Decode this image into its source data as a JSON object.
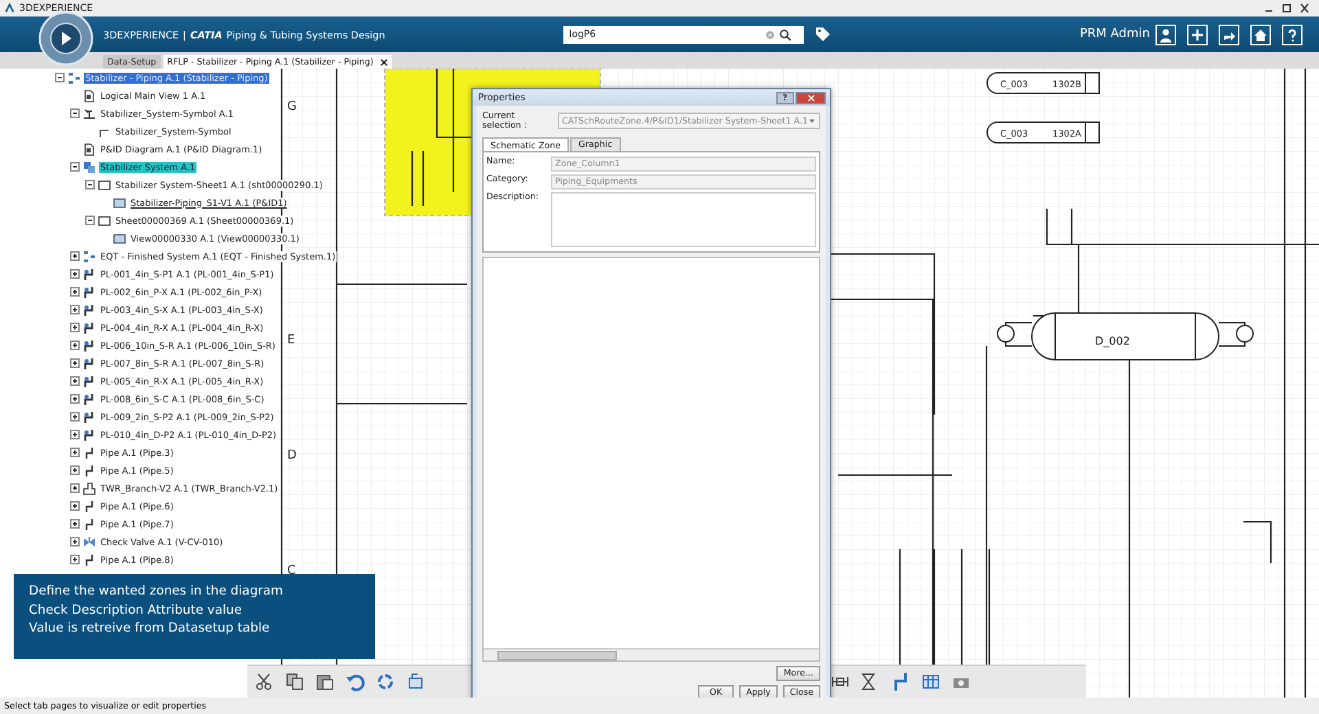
{
  "window": {
    "title": "3DEXPERIENCE"
  },
  "header": {
    "brand": "3DEXPERIENCE",
    "separator": "|",
    "app": "CATIA",
    "app_name": "Piping & Tubing Systems Design",
    "search": {
      "value": "logP6"
    },
    "user": "PRM Admin"
  },
  "tabs": [
    {
      "label": "Data-Setup",
      "selected": false
    },
    {
      "label": "RFLP - Stabilizer - Piping A.1 (Stabilizer - Piping)",
      "selected": true
    }
  ],
  "tree": [
    {
      "label": "Stabilizer - Piping A.1 (Stabilizer - Piping)",
      "kind": "product",
      "expanded": true,
      "selected": true,
      "children": [
        {
          "label": "Logical Main View 1 A.1",
          "kind": "document"
        },
        {
          "label": "Stabilizer_System-Symbol A.1",
          "kind": "symbol",
          "expanded": true,
          "children": [
            {
              "label": "Stabilizer_System-Symbol",
              "kind": "symbol-part"
            }
          ]
        },
        {
          "label": "P&ID Diagram A.1 (P&ID Diagram.1)",
          "kind": "document"
        },
        {
          "label": "Stabilizer System A.1",
          "kind": "system",
          "expanded": true,
          "in_work": true,
          "children": [
            {
              "label": "Stabilizer System-Sheet1 A.1 (sht00000290.1)",
              "kind": "sheet",
              "expanded": true,
              "children": [
                {
                  "label": "Stabilizer-Piping_S1-V1 A.1 (P&ID1)",
                  "kind": "view",
                  "current": true
                }
              ]
            },
            {
              "label": "Sheet00000369 A.1 (Sheet00000369.1)",
              "kind": "sheet",
              "expanded": true,
              "children": [
                {
                  "label": "View00000330 A.1 (View00000330.1)",
                  "kind": "view"
                }
              ]
            }
          ]
        },
        {
          "label": "EQT - Finished System A.1 (EQT - Finished System.1)",
          "kind": "product",
          "expanded": false
        },
        {
          "label": "PL-001_4in_S-P1 A.1 (PL-001_4in_S-P1)",
          "kind": "line",
          "expanded": false
        },
        {
          "label": "PL-002_6in_P-X A.1 (PL-002_6in_P-X)",
          "kind": "line",
          "expanded": false
        },
        {
          "label": "PL-003_4in_S-X A.1 (PL-003_4in_S-X)",
          "kind": "line",
          "expanded": false
        },
        {
          "label": "PL-004_4in_R-X A.1 (PL-004_4in_R-X)",
          "kind": "line",
          "expanded": false
        },
        {
          "label": "PL-006_10in_S-R A.1 (PL-006_10in_S-R)",
          "kind": "line",
          "expanded": false
        },
        {
          "label": "PL-007_8in_S-R A.1 (PL-007_8in_S-R)",
          "kind": "line",
          "expanded": false
        },
        {
          "label": "PL-005_4in_R-X A.1 (PL-005_4in_R-X)",
          "kind": "line",
          "expanded": false
        },
        {
          "label": "PL-008_6in_S-C A.1 (PL-008_6in_S-C)",
          "kind": "line",
          "expanded": false
        },
        {
          "label": "PL-009_2in_S-P2 A.1 (PL-009_2in_S-P2)",
          "kind": "line",
          "expanded": false
        },
        {
          "label": "PL-010_4in_D-P2 A.1 (PL-010_4in_D-P2)",
          "kind": "line",
          "expanded": false
        },
        {
          "label": "Pipe A.1 (Pipe.3)",
          "kind": "pipe",
          "expanded": false
        },
        {
          "label": "Pipe A.1 (Pipe.5)",
          "kind": "pipe",
          "expanded": false
        },
        {
          "label": "TWR_Branch-V2 A.1 (TWR_Branch-V2.1)",
          "kind": "branch",
          "expanded": false
        },
        {
          "label": "Pipe A.1 (Pipe.6)",
          "kind": "pipe",
          "expanded": false
        },
        {
          "label": "Pipe A.1 (Pipe.7)",
          "kind": "pipe",
          "expanded": false
        },
        {
          "label": "Check Valve A.1 (V-CV-010)",
          "kind": "valve",
          "expanded": false
        },
        {
          "label": "Pipe A.1 (Pipe.8)",
          "kind": "pipe",
          "expanded": false
        }
      ]
    }
  ],
  "diagram": {
    "zone_labels": [
      "G",
      "E",
      "D",
      "C"
    ],
    "equipment": [
      {
        "tag": "C_003",
        "number": "1302B"
      },
      {
        "tag": "C_003",
        "number": "1302A"
      },
      {
        "tag": "D_002"
      }
    ]
  },
  "dialog": {
    "title": "Properties",
    "help": "?",
    "current_selection": {
      "label": "Current selection :",
      "value": "CATSchRouteZone.4/P&ID1/Stabilizer System-Sheet1 A.1"
    },
    "tabs": [
      {
        "label": "Schematic Zone",
        "selected": true
      },
      {
        "label": "Graphic",
        "selected": false
      }
    ],
    "fields": [
      {
        "label": "Name:",
        "value": "Zone_Column1",
        "disabled": true
      },
      {
        "label": "Category:",
        "value": "Piping_Equipments",
        "disabled": true
      }
    ],
    "description": {
      "label": "Description:"
    },
    "more_button": "More...",
    "buttons": [
      "OK",
      "Apply",
      "Close"
    ]
  },
  "caption": [
    "Define the wanted zones in the diagram",
    "Check Description Attribute value",
    "Value is retreive from Datasetup table"
  ],
  "status_bar": "Select tab pages to visualize or edit properties"
}
